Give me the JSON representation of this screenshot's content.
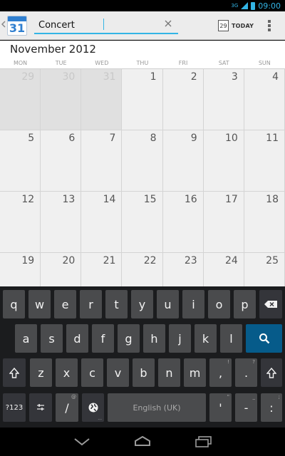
{
  "status_bar": {
    "network": "3G",
    "time": "09:00"
  },
  "action_bar": {
    "app_icon_day": "31",
    "search_value": "Concert",
    "today_day": "29",
    "today_label": "TODAY"
  },
  "calendar": {
    "month_title": "November 2012",
    "weekdays": [
      "MON",
      "TUE",
      "WED",
      "THU",
      "FRI",
      "SAT",
      "SUN"
    ],
    "days": [
      {
        "n": "29",
        "prev": true
      },
      {
        "n": "30",
        "prev": true
      },
      {
        "n": "31",
        "prev": true
      },
      {
        "n": "1"
      },
      {
        "n": "2"
      },
      {
        "n": "3"
      },
      {
        "n": "4"
      },
      {
        "n": "5"
      },
      {
        "n": "6"
      },
      {
        "n": "7"
      },
      {
        "n": "8"
      },
      {
        "n": "9"
      },
      {
        "n": "10"
      },
      {
        "n": "11"
      },
      {
        "n": "12"
      },
      {
        "n": "13"
      },
      {
        "n": "14"
      },
      {
        "n": "15"
      },
      {
        "n": "16"
      },
      {
        "n": "17"
      },
      {
        "n": "18"
      },
      {
        "n": "19"
      },
      {
        "n": "20"
      },
      {
        "n": "21"
      },
      {
        "n": "22"
      },
      {
        "n": "23"
      },
      {
        "n": "24"
      },
      {
        "n": "25"
      }
    ]
  },
  "keyboard": {
    "row1": [
      "q",
      "w",
      "e",
      "r",
      "t",
      "y",
      "u",
      "i",
      "o",
      "p"
    ],
    "row2": [
      "a",
      "s",
      "d",
      "f",
      "g",
      "h",
      "j",
      "k",
      "l"
    ],
    "row3": [
      "z",
      "x",
      "c",
      "v",
      "b",
      "n",
      "m"
    ],
    "exclaim_key": ",",
    "exclaim_hint": "!",
    "question_key": ".",
    "question_hint": "?",
    "symbols_label": "?123",
    "slash_key": "/",
    "slash_hint": "@",
    "space_label": "English (UK)",
    "apostrophe_key": "'",
    "apostrophe_hint": "\"",
    "dash_key": "-",
    "dash_hint": "_",
    "colon_key": ":",
    "colon_hint": ";"
  }
}
